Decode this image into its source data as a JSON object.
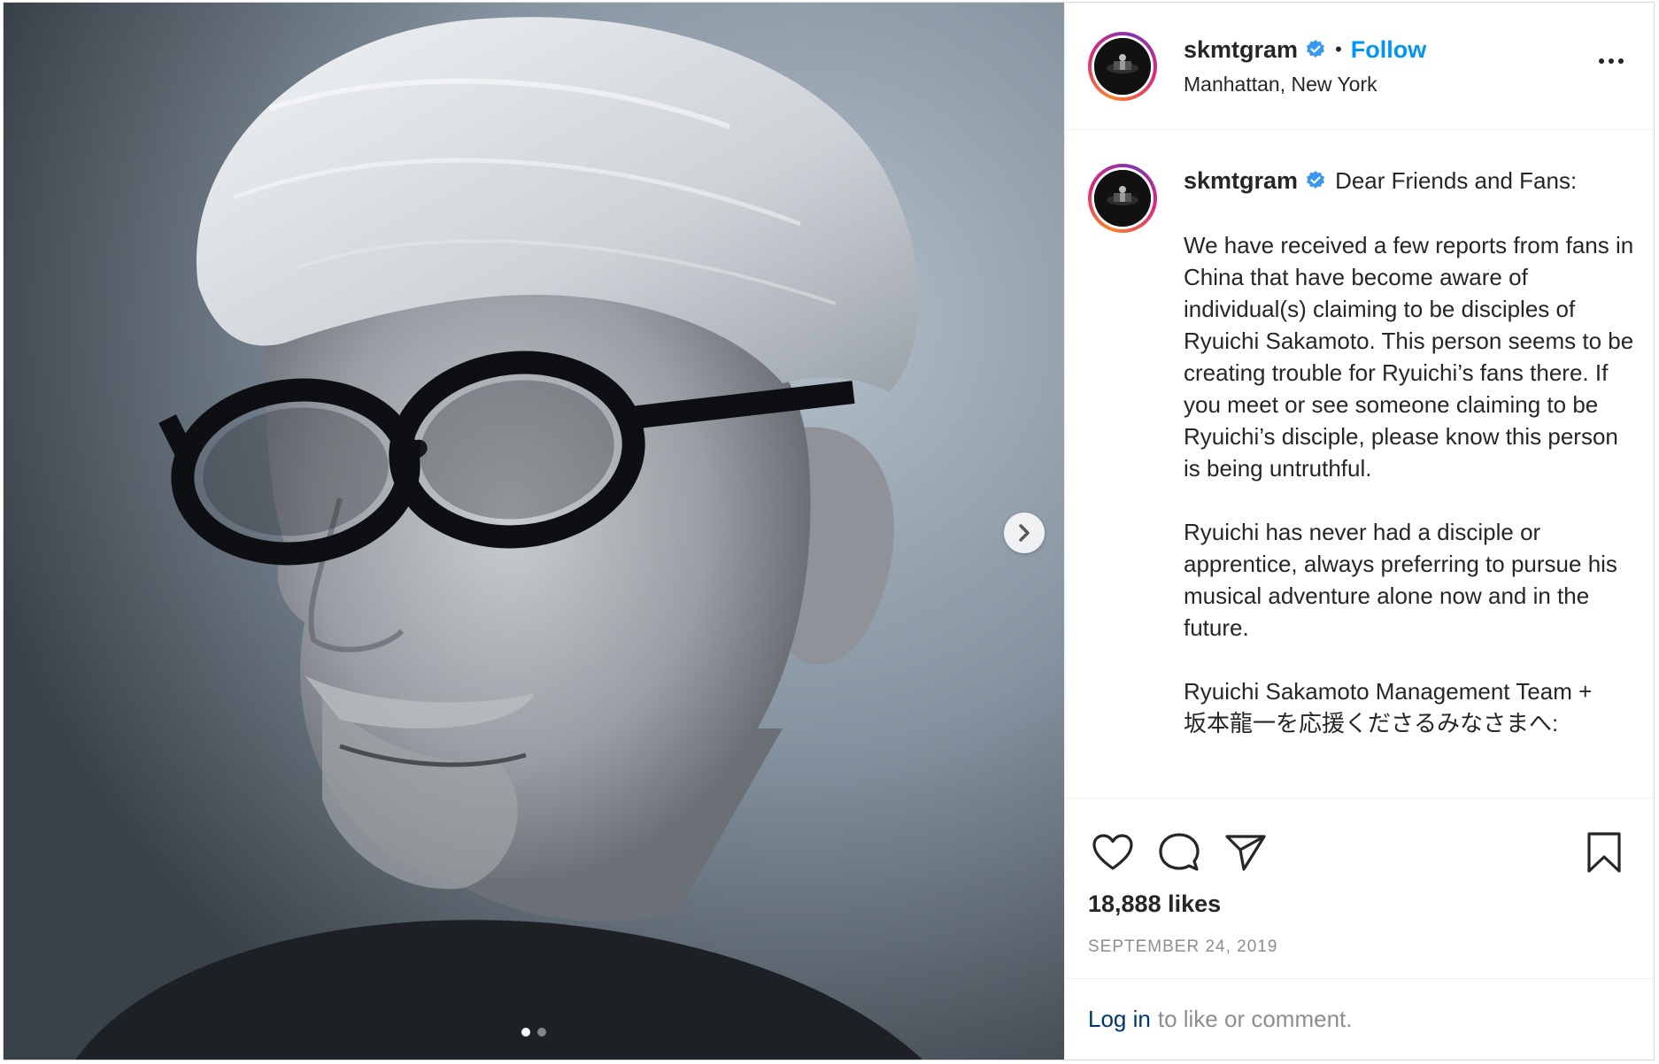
{
  "post": {
    "account": {
      "username": "skmtgram",
      "verified": true,
      "follow_label": "Follow",
      "separator": "•",
      "location": "Manhattan, New York"
    },
    "media": {
      "subject": "black-and-white portrait of a man with white hair and round black glasses",
      "carousel_count": 2,
      "carousel_index": 1
    },
    "caption": {
      "username": "skmtgram",
      "lead": "Dear Friends and Fans:",
      "paragraphs": [
        "We have received a few reports from fans in China that have become aware of individual(s) claiming to be disciples of Ryuichi Sakamoto. This person seems to be creating trouble for Ryuichi’s fans there. If you meet or see someone claiming to be Ryuichi’s disciple, please know this person is being untruthful.",
        "Ryuichi has never had a disciple or apprentice, always preferring to pursue his musical adventure alone now and in the future."
      ],
      "signoff_lines": [
        "Ryuichi Sakamoto Management Team +",
        "坂本龍一を応援くださるみなさまへ:"
      ]
    },
    "likes": "18,888 likes",
    "date": "SEPTEMBER 24, 2019",
    "footer": {
      "login_label": "Log in",
      "rest": "to like or comment."
    },
    "icons": {
      "like": "heart-icon",
      "comment": "comment-icon",
      "share": "share-icon",
      "save": "bookmark-icon",
      "more": "more-options-icon",
      "next": "chevron-right-icon",
      "verified": "verified-badge-icon"
    },
    "colors": {
      "accent": "#0095f6",
      "verified": "#3897f0",
      "link": "#00376b",
      "muted": "#8e8e8e",
      "text": "#262626"
    }
  }
}
